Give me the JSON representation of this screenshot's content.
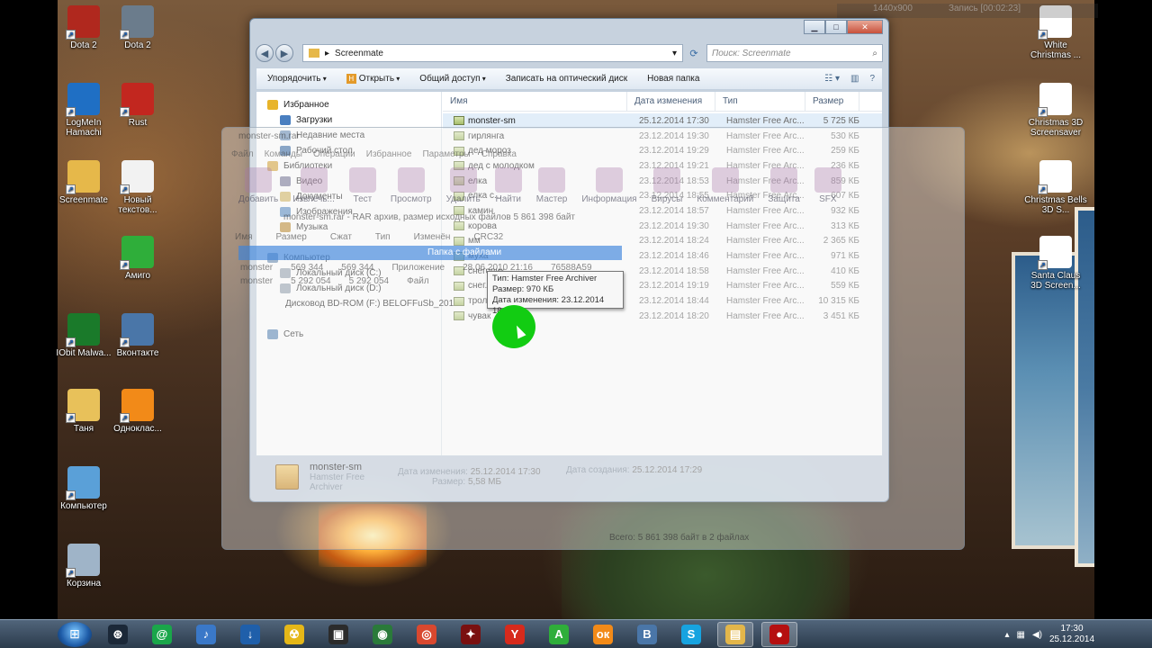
{
  "desktop_icons": [
    {
      "id": "dota2-a",
      "label": "Dota 2",
      "color": "#b0281e"
    },
    {
      "id": "dota2-b",
      "label": "Dota 2",
      "color": "#6b7c8c"
    },
    {
      "id": "hamachi",
      "label": "LogMeIn Hamachi",
      "color": "#1f6fc4"
    },
    {
      "id": "rust",
      "label": "Rust",
      "color": "#c2271f"
    },
    {
      "id": "screenmate",
      "label": "Screenmate",
      "color": "#e6b84a"
    },
    {
      "id": "new-text",
      "label": "Новый текстов...",
      "color": "#f2f2f2"
    },
    {
      "id": "amigo",
      "label": "Амиго",
      "color": "#2fae3a"
    },
    {
      "id": "iobit",
      "label": "IObit Malwa...",
      "color": "#1a7a2a"
    },
    {
      "id": "vkontakte",
      "label": "Вконтакте",
      "color": "#4a76a8"
    },
    {
      "id": "tanya",
      "label": "Таня",
      "color": "#e8c15a"
    },
    {
      "id": "odnoklassniki",
      "label": "Одноклас...",
      "color": "#f28a18"
    },
    {
      "id": "computer",
      "label": "Компьютер",
      "color": "#5aa0d8"
    },
    {
      "id": "recycle-bin",
      "label": "Корзина",
      "color": "#9fb4c8"
    },
    {
      "id": "white-christmas",
      "label": "White Christmas ...",
      "color": "#ffffff"
    },
    {
      "id": "christmas-3d",
      "label": "Christmas 3D Screensaver",
      "color": "#ffffff"
    },
    {
      "id": "christmas-bells",
      "label": "Christmas Bells 3D S...",
      "color": "#ffffff"
    },
    {
      "id": "santa-claus",
      "label": "Santa Claus 3D Screen...",
      "color": "#ffffff"
    }
  ],
  "recorder": {
    "resolution": "1440x900",
    "status": "Запись [00:02:23]"
  },
  "explorer": {
    "path": "Screenmate",
    "search_placeholder": "Поиск: Screenmate",
    "toolbar": {
      "organize": "Упорядочить",
      "open": "Открыть",
      "share": "Общий доступ",
      "burn": "Записать на оптический диск",
      "new_folder": "Новая папка"
    },
    "nav": [
      {
        "label": "Избранное",
        "indent": 0,
        "color": "#e8b42a"
      },
      {
        "label": "Загрузки",
        "indent": 1,
        "color": "#4a7fc0"
      },
      {
        "label": "Недавние места",
        "indent": 1,
        "color": "#6b8fb8"
      },
      {
        "label": "Рабочий стол",
        "indent": 1,
        "color": "#3e6ea8"
      },
      {
        "label": "Библиотеки",
        "indent": 0,
        "color": "#d8a840"
      },
      {
        "label": "Видео",
        "indent": 1,
        "color": "#7c7c9c"
      },
      {
        "label": "Документы",
        "indent": 1,
        "color": "#d4b868"
      },
      {
        "label": "Изображения",
        "indent": 1,
        "color": "#5e8fc4"
      },
      {
        "label": "Музыка",
        "indent": 1,
        "color": "#c0903a"
      },
      {
        "label": "",
        "indent": 0,
        "color": "transparent"
      },
      {
        "label": "Компьютер",
        "indent": 0,
        "color": "#6c8eb4"
      },
      {
        "label": "Локальный диск (C:)",
        "indent": 1,
        "color": "#9aa6b4"
      },
      {
        "label": "Локальный диск (D:)",
        "indent": 1,
        "color": "#9aa6b4"
      },
      {
        "label": "Дисковод BD-ROM (F:) BELOFFuSb_201",
        "indent": 1,
        "color": "#9aa6b4"
      },
      {
        "label": "",
        "indent": 0,
        "color": "transparent"
      },
      {
        "label": "Сеть",
        "indent": 0,
        "color": "#5f8ab8"
      }
    ],
    "columns": {
      "name": "Имя",
      "date": "Дата изменения",
      "type": "Тип",
      "size": "Размер"
    },
    "files": [
      {
        "name": "monster-sm",
        "date": "25.12.2014 17:30",
        "type": "Hamster Free Arc...",
        "size": "5 725 КБ",
        "selected": true
      },
      {
        "name": "гирлянга",
        "date": "23.12.2014 19:30",
        "type": "Hamster Free Arc...",
        "size": "530 КБ",
        "selected": false
      },
      {
        "name": "дед мороз",
        "date": "23.12.2014 19:29",
        "type": "Hamster Free Arc...",
        "size": "259 КБ",
        "selected": false
      },
      {
        "name": "дед с молодком",
        "date": "23.12.2014 19:21",
        "type": "Hamster Free Arc...",
        "size": "236 КБ",
        "selected": false
      },
      {
        "name": "елка",
        "date": "23.12.2014 18:53",
        "type": "Hamster Free Arc...",
        "size": "859 КБ",
        "selected": false
      },
      {
        "name": "елка с...",
        "date": "23.12.2014 18:55",
        "type": "Hamster Free Arc...",
        "size": "607 КБ",
        "selected": false
      },
      {
        "name": "камин",
        "date": "23.12.2014 18:57",
        "type": "Hamster Free Arc...",
        "size": "932 КБ",
        "selected": false
      },
      {
        "name": "корова",
        "date": "23.12.2014 19:30",
        "type": "Hamster Free Arc...",
        "size": "313 КБ",
        "selected": false
      },
      {
        "name": "мм",
        "date": "23.12.2014 18:24",
        "type": "Hamster Free Arc...",
        "size": "2 365 КБ",
        "selected": false
      },
      {
        "name": "муха",
        "date": "23.12.2014 18:46",
        "type": "Hamster Free Arc...",
        "size": "971 КБ",
        "selected": false
      },
      {
        "name": "снеговик",
        "date": "23.12.2014 18:58",
        "type": "Hamster Free Arc...",
        "size": "410 КБ",
        "selected": false
      },
      {
        "name": "снег...",
        "date": "23.12.2014 19:19",
        "type": "Hamster Free Arc...",
        "size": "559 КБ",
        "selected": false
      },
      {
        "name": "трол...",
        "date": "23.12.2014 18:44",
        "type": "Hamster Free Arc...",
        "size": "10 315 КБ",
        "selected": false
      },
      {
        "name": "чувак",
        "date": "23.12.2014 18:20",
        "type": "Hamster Free Arc...",
        "size": "3 451 КБ",
        "selected": false
      }
    ],
    "details": {
      "name": "monster-sm",
      "type": "Hamster Free Archiver",
      "modified_label": "Дата изменения:",
      "modified": "25.12.2014 17:30",
      "created_label": "Дата создания:",
      "created": "25.12.2014 17:29",
      "size_label": "Размер:",
      "size": "5,58 МБ"
    }
  },
  "tooltip": {
    "type": "Тип: Hamster Free Archiver",
    "size": "Размер: 970 КБ",
    "modified": "Дата изменения: 23.12.2014 18:46"
  },
  "archiver_ghost": {
    "title": "monster-sm.rar",
    "menu": [
      "Файл",
      "Команды",
      "Операции",
      "Избранное",
      "Параметры",
      "Справка"
    ],
    "tools": [
      "Добавить",
      "Извлечь...",
      "Тест",
      "Просмотр",
      "Удалить",
      "Найти",
      "Мастер",
      "Информация",
      "Вирусы",
      "Комментарий",
      "Защита",
      "SFX"
    ],
    "path": "monster-sm.rar - RAR архив, размер исходных файлов 5 861 398 байт",
    "head": [
      "Имя",
      "Размер",
      "Сжат",
      "Тип",
      "Изменён",
      "CRC32"
    ],
    "selected_row": "Папка с файлами",
    "row1": [
      "monster",
      "569 344",
      "569 344",
      "Приложение",
      "28.06.2010 21:16",
      "76588A59"
    ],
    "row2": [
      "monster",
      "5 292 054",
      "5 292 054",
      "Файл"
    ],
    "status": "Всего: 5 861 398 байт в 2 файлах"
  },
  "taskbar": {
    "apps": [
      {
        "id": "steam",
        "color": "#1b2838",
        "glyph": "⊛"
      },
      {
        "id": "agent",
        "color": "#1aa64a",
        "glyph": "@"
      },
      {
        "id": "speaker",
        "color": "#3a78c8",
        "glyph": "♪"
      },
      {
        "id": "downloads",
        "color": "#1f5faa",
        "glyph": "↓"
      },
      {
        "id": "radiation",
        "color": "#e5b718",
        "glyph": "☢"
      },
      {
        "id": "gta",
        "color": "#2b2b2b",
        "glyph": "▣"
      },
      {
        "id": "globe",
        "color": "#2a7a3a",
        "glyph": "◉"
      },
      {
        "id": "chrome",
        "color": "#d9482f",
        "glyph": "◎"
      },
      {
        "id": "game",
        "color": "#7a1010",
        "glyph": "✦"
      },
      {
        "id": "yandex",
        "color": "#d62a1c",
        "glyph": "Y"
      },
      {
        "id": "amigo",
        "color": "#2fae3a",
        "glyph": "A"
      },
      {
        "id": "odnoklassniki",
        "color": "#f28a18",
        "glyph": "ок"
      },
      {
        "id": "vkontakte",
        "color": "#4a76a8",
        "glyph": "B"
      },
      {
        "id": "skype",
        "color": "#17a3e0",
        "glyph": "S"
      },
      {
        "id": "explorer",
        "color": "#e3b64a",
        "glyph": "▤",
        "active": true
      },
      {
        "id": "recorder",
        "color": "#b51010",
        "glyph": "●",
        "active": true
      }
    ],
    "time": "17:30",
    "date": "25.12.2014"
  }
}
